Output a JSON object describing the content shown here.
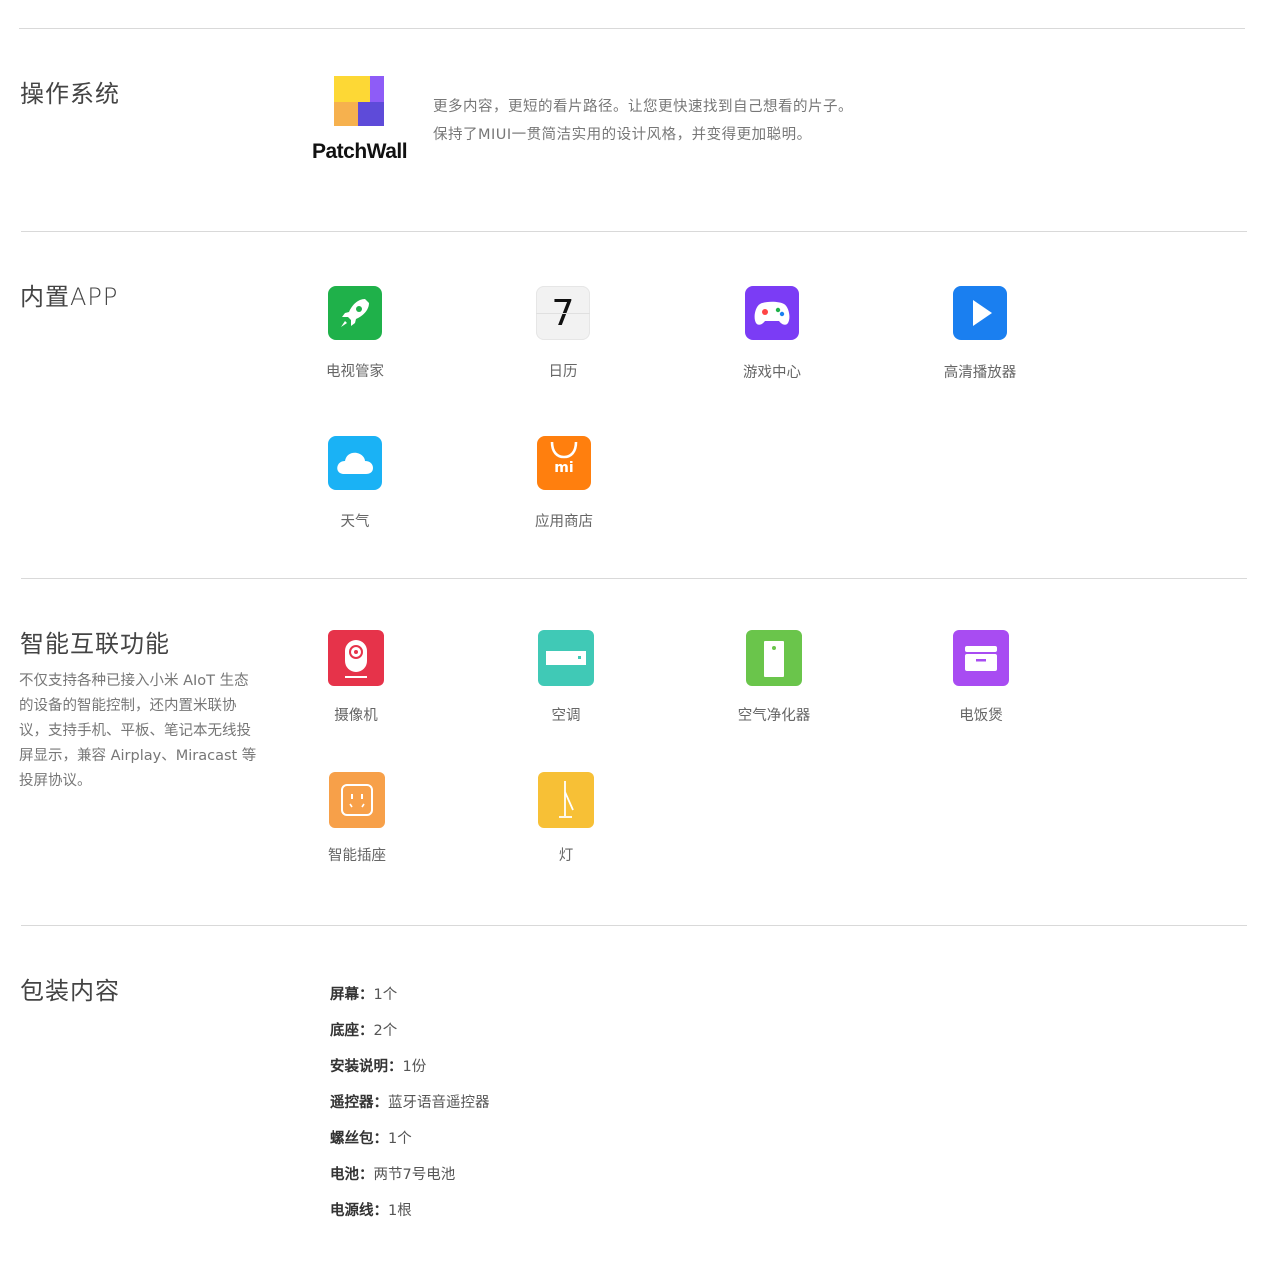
{
  "sections": {
    "os": {
      "title": "操作系统",
      "logo_text": "PatchWall",
      "desc_line1": "更多内容，更短的看片路径。让您更快速找到自己想看的片子。",
      "desc_line2": "保持了MIUI一贯简洁实用的设计风格，并变得更加聪明。"
    },
    "apps": {
      "title": "内置APP",
      "items": [
        {
          "label": "电视管家",
          "icon": "rocket-icon",
          "color": "#1fb14a"
        },
        {
          "label": "日历",
          "icon": "calendar-icon",
          "color": "#f2f2f2",
          "day": "7"
        },
        {
          "label": "游戏中心",
          "icon": "gamepad-icon",
          "color": "#7b3cf5"
        },
        {
          "label": "高清播放器",
          "icon": "play-icon",
          "color": "#1a7ff0"
        },
        {
          "label": "天气",
          "icon": "cloud-icon",
          "color": "#1ab2f5"
        },
        {
          "label": "应用商店",
          "icon": "mi-bag-icon",
          "color": "#ff7f0e",
          "icon_text": "mi"
        }
      ]
    },
    "smart": {
      "title": "智能互联功能",
      "description": "不仅支持各种已接入小米 AIoT 生态的设备的智能控制，还内置米联协议，支持手机、平板、笔记本无线投屏显示，兼容 Airplay、Miracast 等投屏协议。",
      "items": [
        {
          "label": "摄像机",
          "icon": "camera-icon",
          "color": "#e6334a"
        },
        {
          "label": "空调",
          "icon": "air-conditioner-icon",
          "color": "#40c9b6"
        },
        {
          "label": "空气净化器",
          "icon": "air-purifier-icon",
          "color": "#6ac54b"
        },
        {
          "label": "电饭煲",
          "icon": "rice-cooker-icon",
          "color": "#a84cf2"
        },
        {
          "label": "智能插座",
          "icon": "smart-socket-icon",
          "color": "#f7a049"
        },
        {
          "label": "灯",
          "icon": "lamp-icon",
          "color": "#f7c036"
        }
      ]
    },
    "package": {
      "title": "包装内容",
      "items": [
        {
          "name": "屏幕：",
          "value": "1个"
        },
        {
          "name": "底座：",
          "value": "2个"
        },
        {
          "name": "安装说明：",
          "value": "1份"
        },
        {
          "name": "遥控器：",
          "value": "蓝牙语音遥控器"
        },
        {
          "name": "螺丝包：",
          "value": "1个"
        },
        {
          "name": "电池：",
          "value": "两节7号电池"
        },
        {
          "name": "电源线：",
          "value": "1根"
        }
      ]
    }
  }
}
